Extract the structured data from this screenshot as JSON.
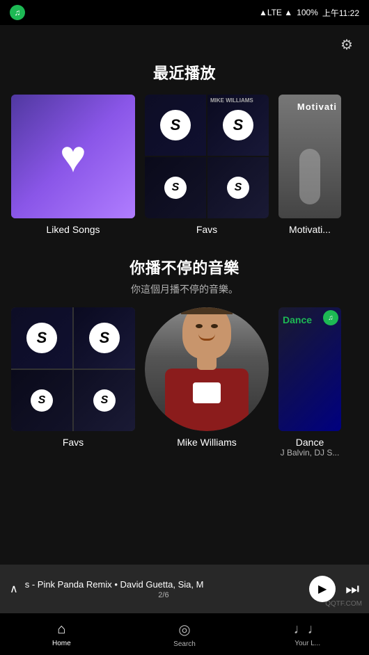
{
  "status": {
    "carrier": "",
    "network": "LTE",
    "battery": "100%",
    "time": "上午11:22"
  },
  "header": {
    "section1_title": "最近播放",
    "settings_label": "⚙"
  },
  "recently_played": {
    "items": [
      {
        "id": "liked-songs",
        "label": "Liked Songs",
        "type": "liked"
      },
      {
        "id": "favs",
        "label": "Favs",
        "type": "favs"
      },
      {
        "id": "motivati",
        "label": "Motivati...",
        "type": "motivati"
      }
    ]
  },
  "section2": {
    "title": "你播不停的音樂",
    "subtitle": "你這個月播不停的音樂。",
    "items": [
      {
        "id": "favs2",
        "label": "Favs",
        "sublabel": "",
        "type": "favs"
      },
      {
        "id": "mike-williams",
        "label": "Mike Williams",
        "sublabel": "",
        "type": "artist"
      },
      {
        "id": "dance",
        "label": "Dance",
        "sublabel": "J Balvin, DJ S...",
        "type": "dance"
      }
    ]
  },
  "now_playing": {
    "expand_icon": "∧",
    "track": "s - Pink Panda Remix • David Guetta, Sia, M",
    "page": "2/6"
  },
  "bottom_nav": {
    "items": [
      {
        "id": "home",
        "label": "Home",
        "icon": "⌂",
        "active": true
      },
      {
        "id": "search",
        "label": "Search",
        "icon": "◎",
        "active": false
      },
      {
        "id": "your-library",
        "label": "Your L...",
        "icon": "𝄞",
        "active": false
      }
    ]
  }
}
